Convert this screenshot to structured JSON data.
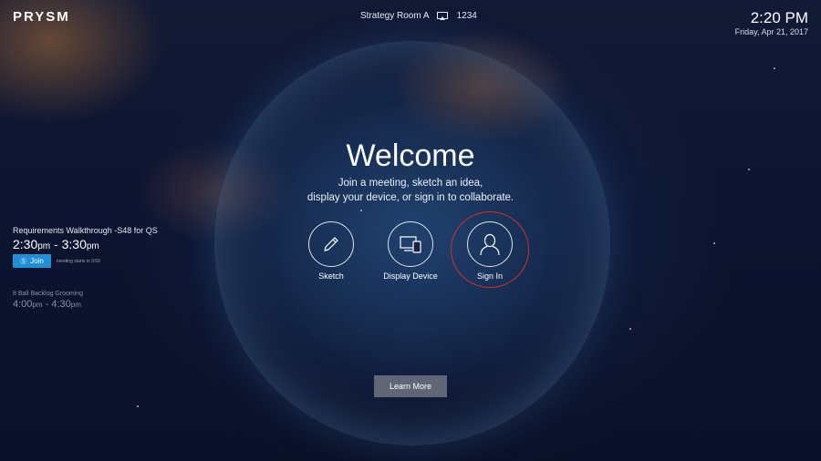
{
  "brand": {
    "logo_text": "PRYSM"
  },
  "header": {
    "room_name": "Strategy Room A",
    "room_code": "1234",
    "time": "2:20 PM",
    "date": "Friday, Apr 21, 2017"
  },
  "meetings": [
    {
      "title": "Requirements Walkthrough -S48 for QS",
      "start": "2:30",
      "start_ampm": "pm",
      "end": "3:30",
      "end_ampm": "pm",
      "join_label": "Join",
      "starts_text": "meeting starts in 9:59"
    },
    {
      "title": "8 Ball Backlog Grooming",
      "start": "4:00",
      "start_ampm": "pm",
      "end": "4:30",
      "end_ampm": "pm"
    }
  ],
  "welcome": {
    "heading": "Welcome",
    "line1": "Join a meeting, sketch an idea,",
    "line2": "display your device, or sign in to collaborate."
  },
  "actions": {
    "sketch": "Sketch",
    "display_device": "Display Device",
    "sign_in": "Sign In"
  },
  "learn_more": "Learn More",
  "colors": {
    "join_button": "#1f8fd8",
    "highlight_ring": "#d92b2b",
    "learn_more_bg": "#6e7380"
  },
  "icons": [
    "screen-cast-icon",
    "skype-icon",
    "pencil-icon",
    "devices-icon",
    "user-icon"
  ]
}
